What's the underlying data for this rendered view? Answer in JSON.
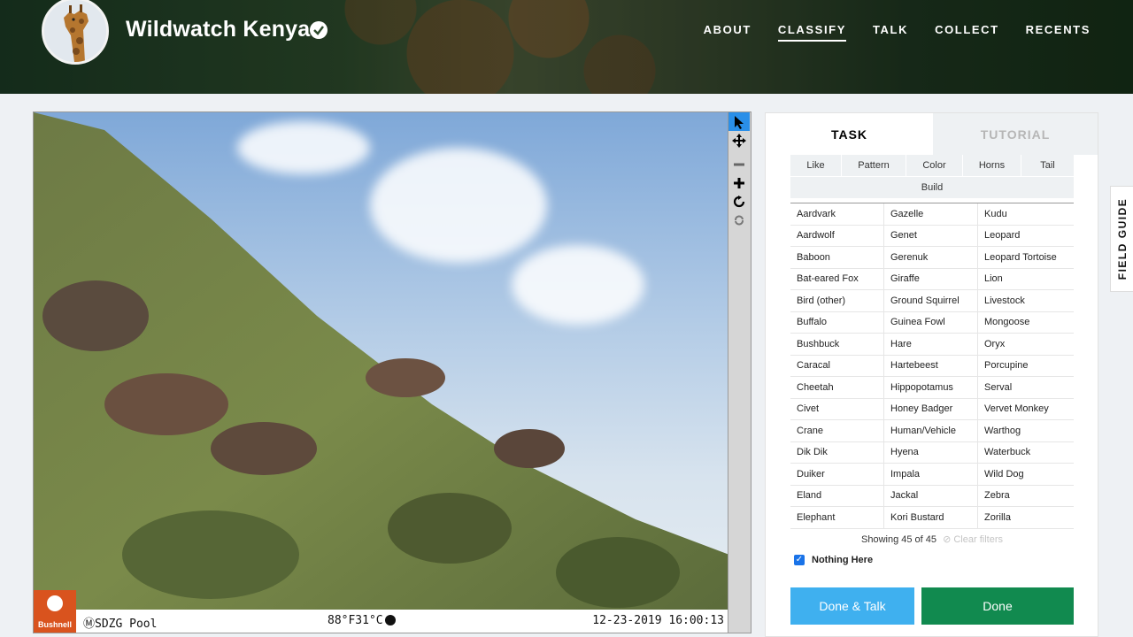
{
  "header": {
    "project_name": "Wildwatch Kenya",
    "nav": [
      {
        "label": "ABOUT",
        "active": false
      },
      {
        "label": "CLASSIFY",
        "active": true
      },
      {
        "label": "TALK",
        "active": false
      },
      {
        "label": "COLLECT",
        "active": false
      },
      {
        "label": "RECENTS",
        "active": false
      }
    ]
  },
  "viewer": {
    "brand_badge": "Bushnell",
    "camera_label": "SDZG Pool",
    "temperature": "88°F31°C",
    "datetime": "12-23-2019 16:00:13",
    "tools": [
      "pointer-icon",
      "move-icon",
      "zoom-out-icon",
      "zoom-in-icon",
      "rotate-icon",
      "reset-icon"
    ]
  },
  "panel": {
    "tabs": [
      "TASK",
      "TUTORIAL"
    ],
    "filters_row1": [
      "Like",
      "Pattern",
      "Color",
      "Horns",
      "Tail"
    ],
    "filters_row2": [
      "Build"
    ],
    "choices": [
      [
        "Aardvark",
        "Gazelle",
        "Kudu"
      ],
      [
        "Aardwolf",
        "Genet",
        "Leopard"
      ],
      [
        "Baboon",
        "Gerenuk",
        "Leopard Tortoise"
      ],
      [
        "Bat-eared Fox",
        "Giraffe",
        "Lion"
      ],
      [
        "Bird (other)",
        "Ground Squirrel",
        "Livestock"
      ],
      [
        "Buffalo",
        "Guinea Fowl",
        "Mongoose"
      ],
      [
        "Bushbuck",
        "Hare",
        "Oryx"
      ],
      [
        "Caracal",
        "Hartebeest",
        "Porcupine"
      ],
      [
        "Cheetah",
        "Hippopotamus",
        "Serval"
      ],
      [
        "Civet",
        "Honey Badger",
        "Vervet Monkey"
      ],
      [
        "Crane",
        "Human/Vehicle",
        "Warthog"
      ],
      [
        "Dik Dik",
        "Hyena",
        "Waterbuck"
      ],
      [
        "Duiker",
        "Impala",
        "Wild Dog"
      ],
      [
        "Eland",
        "Jackal",
        "Zebra"
      ],
      [
        "Elephant",
        "Kori Bustard",
        "Zorilla"
      ]
    ],
    "showing": "Showing 45 of 45",
    "clear_filters": "Clear filters",
    "nothing_here": "Nothing Here",
    "nothing_here_checked": true,
    "done_talk": "Done & Talk",
    "done": "Done"
  },
  "field_guide": "FIELD GUIDE",
  "colors": {
    "done_talk_bg": "#3fb0ef",
    "done_bg": "#118a4f",
    "active_tool": "#2a8fe8"
  }
}
